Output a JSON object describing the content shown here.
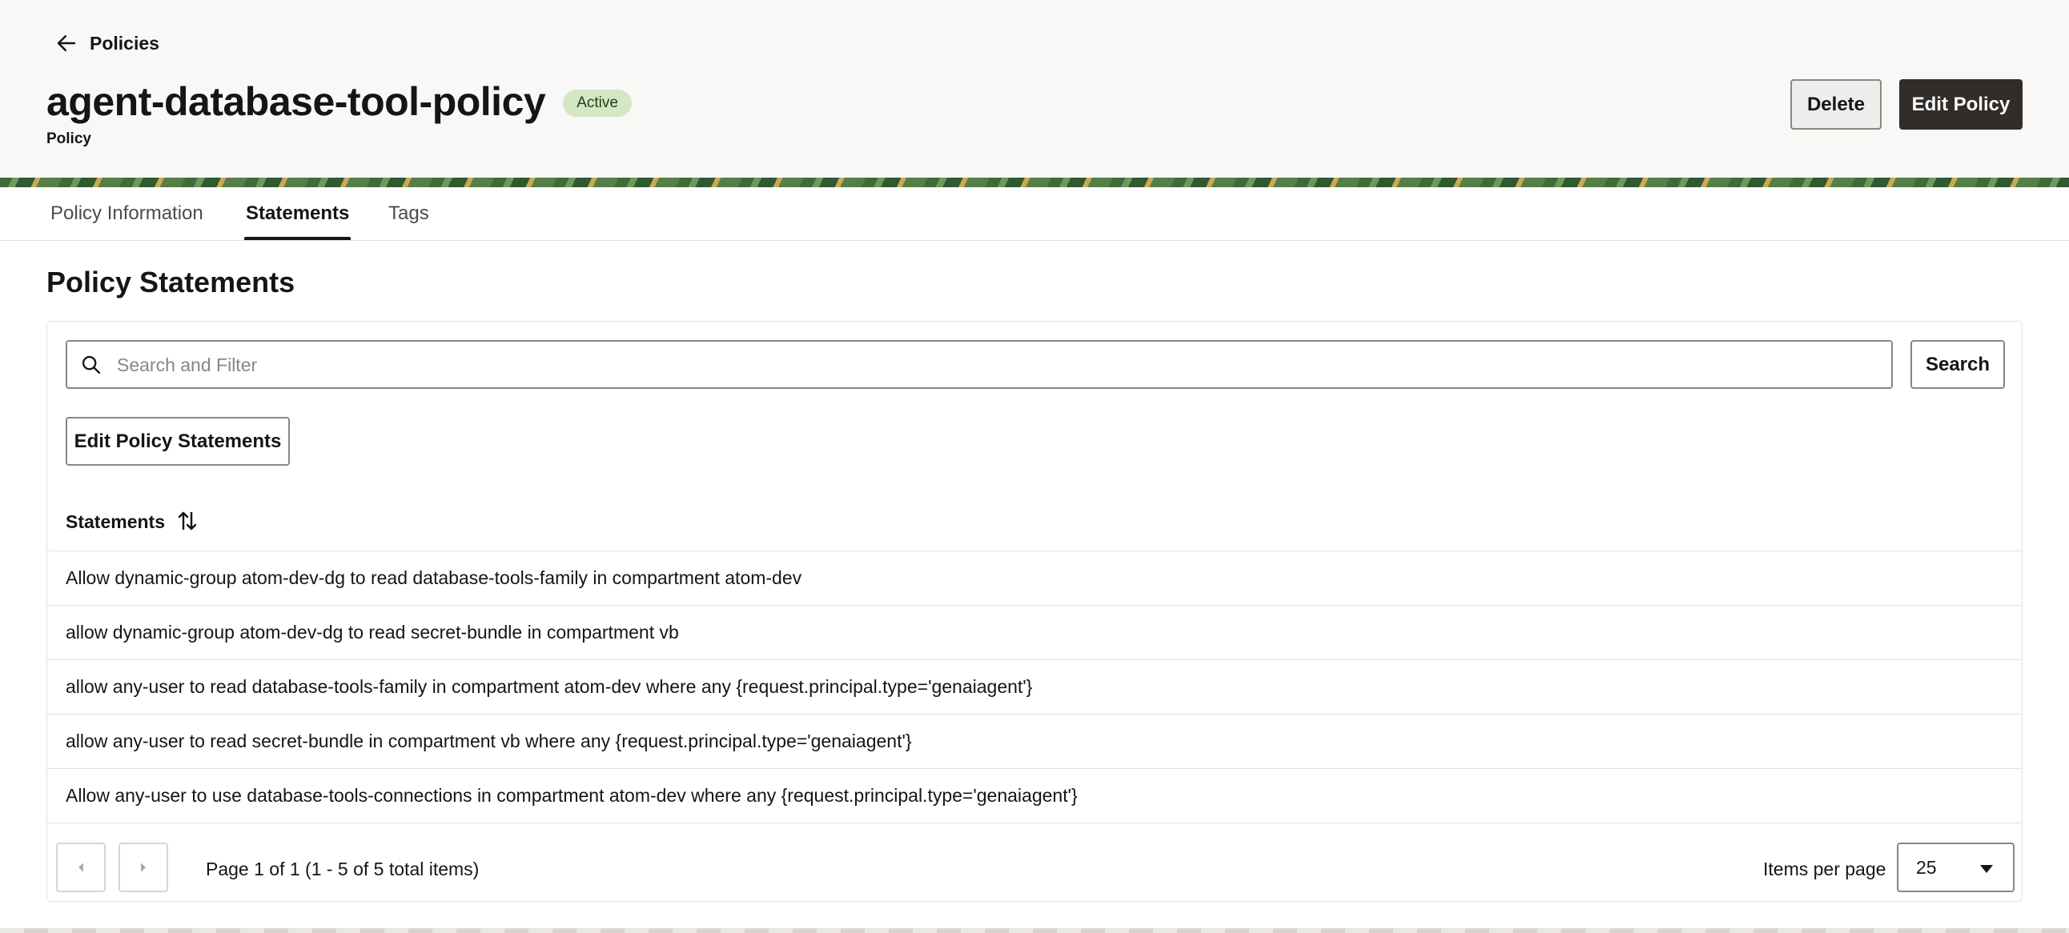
{
  "header": {
    "back_label": "Policies",
    "title": "agent-database-tool-policy",
    "status": "Active",
    "subtitle": "Policy",
    "delete_label": "Delete",
    "edit_label": "Edit Policy"
  },
  "tabs": [
    {
      "label": "Policy Information",
      "active": false
    },
    {
      "label": "Statements",
      "active": true
    },
    {
      "label": "Tags",
      "active": false
    }
  ],
  "main": {
    "section_title": "Policy Statements",
    "search_placeholder": "Search and Filter",
    "search_button": "Search",
    "edit_statements_button": "Edit Policy Statements",
    "column_header": "Statements",
    "rows": [
      "Allow dynamic-group atom-dev-dg to read database-tools-family in compartment atom-dev",
      "allow dynamic-group atom-dev-dg to read secret-bundle in compartment vb",
      "allow any-user to read database-tools-family in compartment atom-dev where any {request.principal.type='genaiagent'}",
      "allow any-user to read secret-bundle in compartment vb where any {request.principal.type='genaiagent'}",
      "Allow any-user to use database-tools-connections in compartment atom-dev where any {request.principal.type='genaiagent'}"
    ]
  },
  "pagination": {
    "text": "Page 1 of 1 (1 - 5 of 5 total items)",
    "items_per_page_label": "Items per page",
    "items_per_page_value": "25"
  },
  "colors": {
    "primary_button": "#312d2a",
    "badge_bg": "#d4e7c4",
    "header_bg": "#f9f8f6"
  }
}
